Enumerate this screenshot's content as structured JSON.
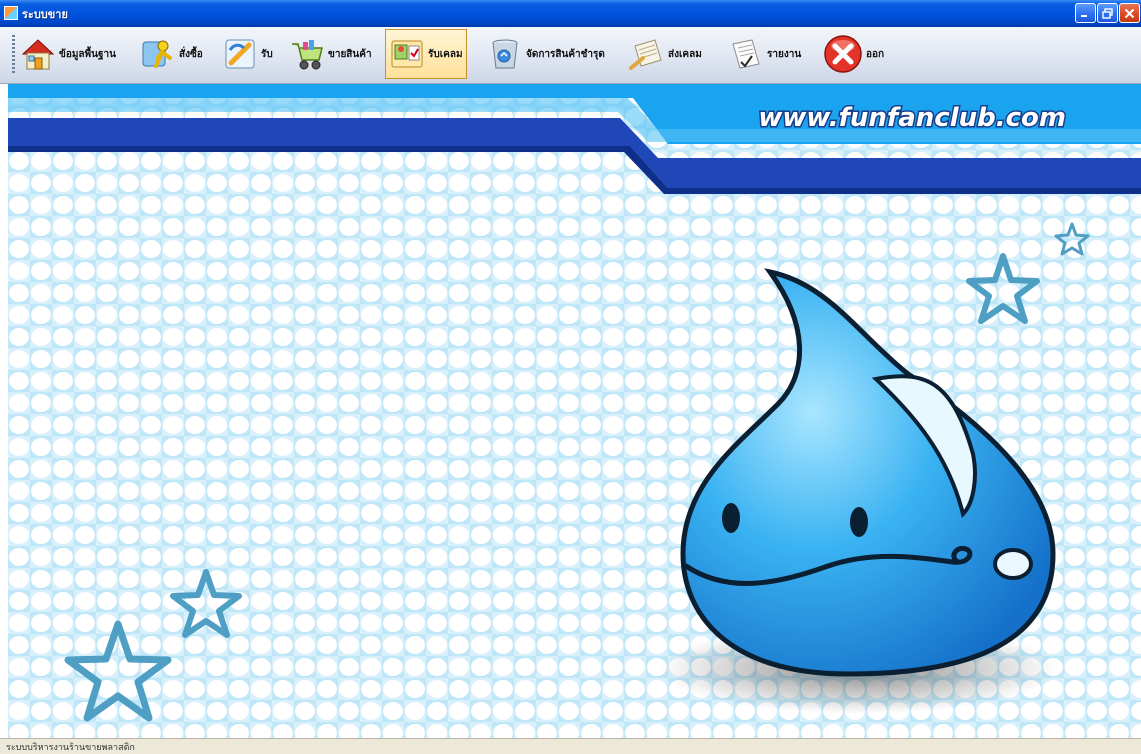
{
  "window": {
    "title": "ระบบขาย",
    "controls": {
      "minimize": "minimize-icon",
      "restore": "restore-icon",
      "close": "close-icon"
    }
  },
  "toolbar": {
    "items": [
      {
        "label": "ข้อมูลพื้นฐาน",
        "icon": "house-icon"
      },
      {
        "label": "สั่งซื้อ",
        "icon": "person-order-icon"
      },
      {
        "label": "รับ",
        "icon": "pencil-paper-icon"
      },
      {
        "label": "ขายสินค้า",
        "icon": "shopping-cart-icon"
      },
      {
        "label": "รับเคลม",
        "icon": "claim-board-icon",
        "active": true
      },
      {
        "label": "จัดการสินค้าชำรุด",
        "icon": "recycle-bin-icon"
      },
      {
        "label": "ส่งเคลม",
        "icon": "send-paper-icon"
      },
      {
        "label": "รายงาน",
        "icon": "report-icon"
      },
      {
        "label": "ออก",
        "icon": "exit-icon"
      }
    ]
  },
  "banner": {
    "website": "www.funfanclub.com"
  },
  "colors": {
    "titlebar": "#0052dd",
    "banner_blue": "#1aa3ee",
    "banner_dark": "#1f47b8",
    "pattern_bg": "#bfe7f8",
    "drop_blue": "#2e9ee8",
    "star_blue": "#4f9fc4",
    "active_button": "#ffe19a"
  },
  "status": {
    "text": "ระบบบริหารงานร้านขายพลาสติก"
  }
}
